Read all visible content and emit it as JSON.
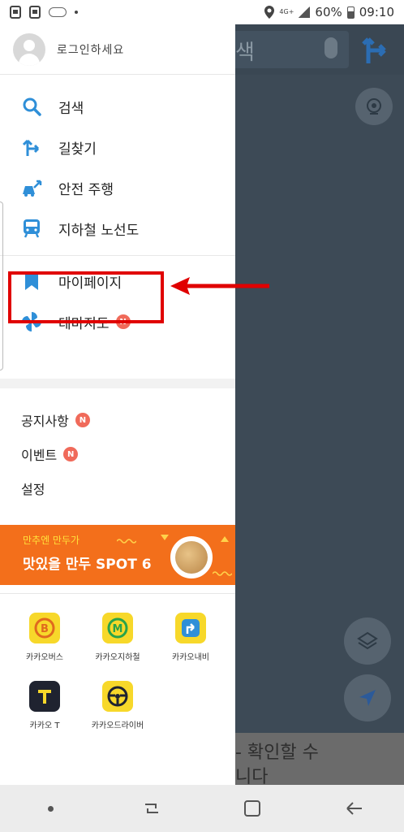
{
  "status_bar": {
    "network": "4G+",
    "battery": "60%",
    "time": "09:10"
  },
  "map_background": {
    "search_fragment": "색",
    "bottom_text_line1": "- 확인할 수",
    "bottom_text_line2": "니다"
  },
  "drawer": {
    "login_prompt": "로그인하세요",
    "menu": [
      {
        "label": "검색",
        "icon": "search-icon"
      },
      {
        "label": "길찾기",
        "icon": "directions-icon"
      },
      {
        "label": "안전 주행",
        "icon": "safe-driving-icon"
      },
      {
        "label": "지하철 노선도",
        "icon": "subway-icon"
      },
      {
        "label": "마이페이지",
        "icon": "bookmark-icon"
      },
      {
        "label": "테마지도",
        "icon": "pinwheel-icon",
        "badge": "N"
      }
    ],
    "sub_menu": [
      {
        "label": "공지사항",
        "badge": "N"
      },
      {
        "label": "이벤트",
        "badge": "N"
      },
      {
        "label": "설정"
      }
    ],
    "banner": {
      "line1": "만추엔 만두가",
      "line2": "맛있을 만두 SPOT 6"
    },
    "apps": [
      {
        "label": "카카오버스",
        "icon": "kakaobus-icon",
        "glyph": "B"
      },
      {
        "label": "카카오지하철",
        "icon": "kakaometro-icon",
        "glyph": "M"
      },
      {
        "label": "카카오내비",
        "icon": "kakaonavi-icon",
        "glyph": "↱"
      },
      {
        "label": "카카오 T",
        "icon": "kakaot-icon",
        "glyph": "T"
      },
      {
        "label": "카카오드라이버",
        "icon": "kakaodriver-icon",
        "glyph": "⊛"
      }
    ]
  },
  "colors": {
    "accent_blue": "#2f8fd8",
    "highlight_red": "#e00000",
    "banner_orange": "#f36f1b",
    "badge_red": "#f06a5a",
    "app_yellow": "#f7d82a"
  }
}
